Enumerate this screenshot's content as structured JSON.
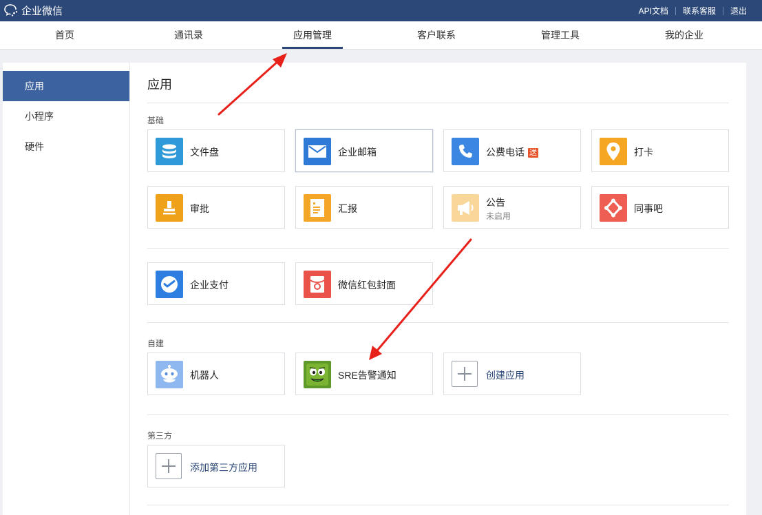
{
  "topbar": {
    "brand": "企业微信",
    "links": [
      "API文档",
      "联系客服",
      "退出"
    ]
  },
  "nav": {
    "items": [
      "首页",
      "通讯录",
      "应用管理",
      "客户联系",
      "管理工具",
      "我的企业"
    ],
    "active_index": 2
  },
  "sidebar": {
    "items": [
      "应用",
      "小程序",
      "硬件"
    ],
    "active_index": 0
  },
  "content": {
    "title": "应用",
    "sections": {
      "basic": "基础",
      "custom": "自建",
      "third": "第三方"
    },
    "apps": {
      "file": "文件盘",
      "mail": "企业邮箱",
      "phone": "公费电话",
      "phone_badge": "送",
      "checkin": "打卡",
      "approval": "审批",
      "report": "汇报",
      "notice": "公告",
      "notice_status": "未启用",
      "colleague": "同事吧",
      "pay": "企业支付",
      "redpacket": "微信红包封面",
      "robot": "机器人",
      "sre": "SRE告警通知",
      "create": "创建应用",
      "add_third": "添加第三方应用"
    }
  },
  "colors": {
    "topbar": "#2c4878",
    "sidebar_active": "#3c62a0",
    "annotation_arrow": "#e8201a"
  }
}
